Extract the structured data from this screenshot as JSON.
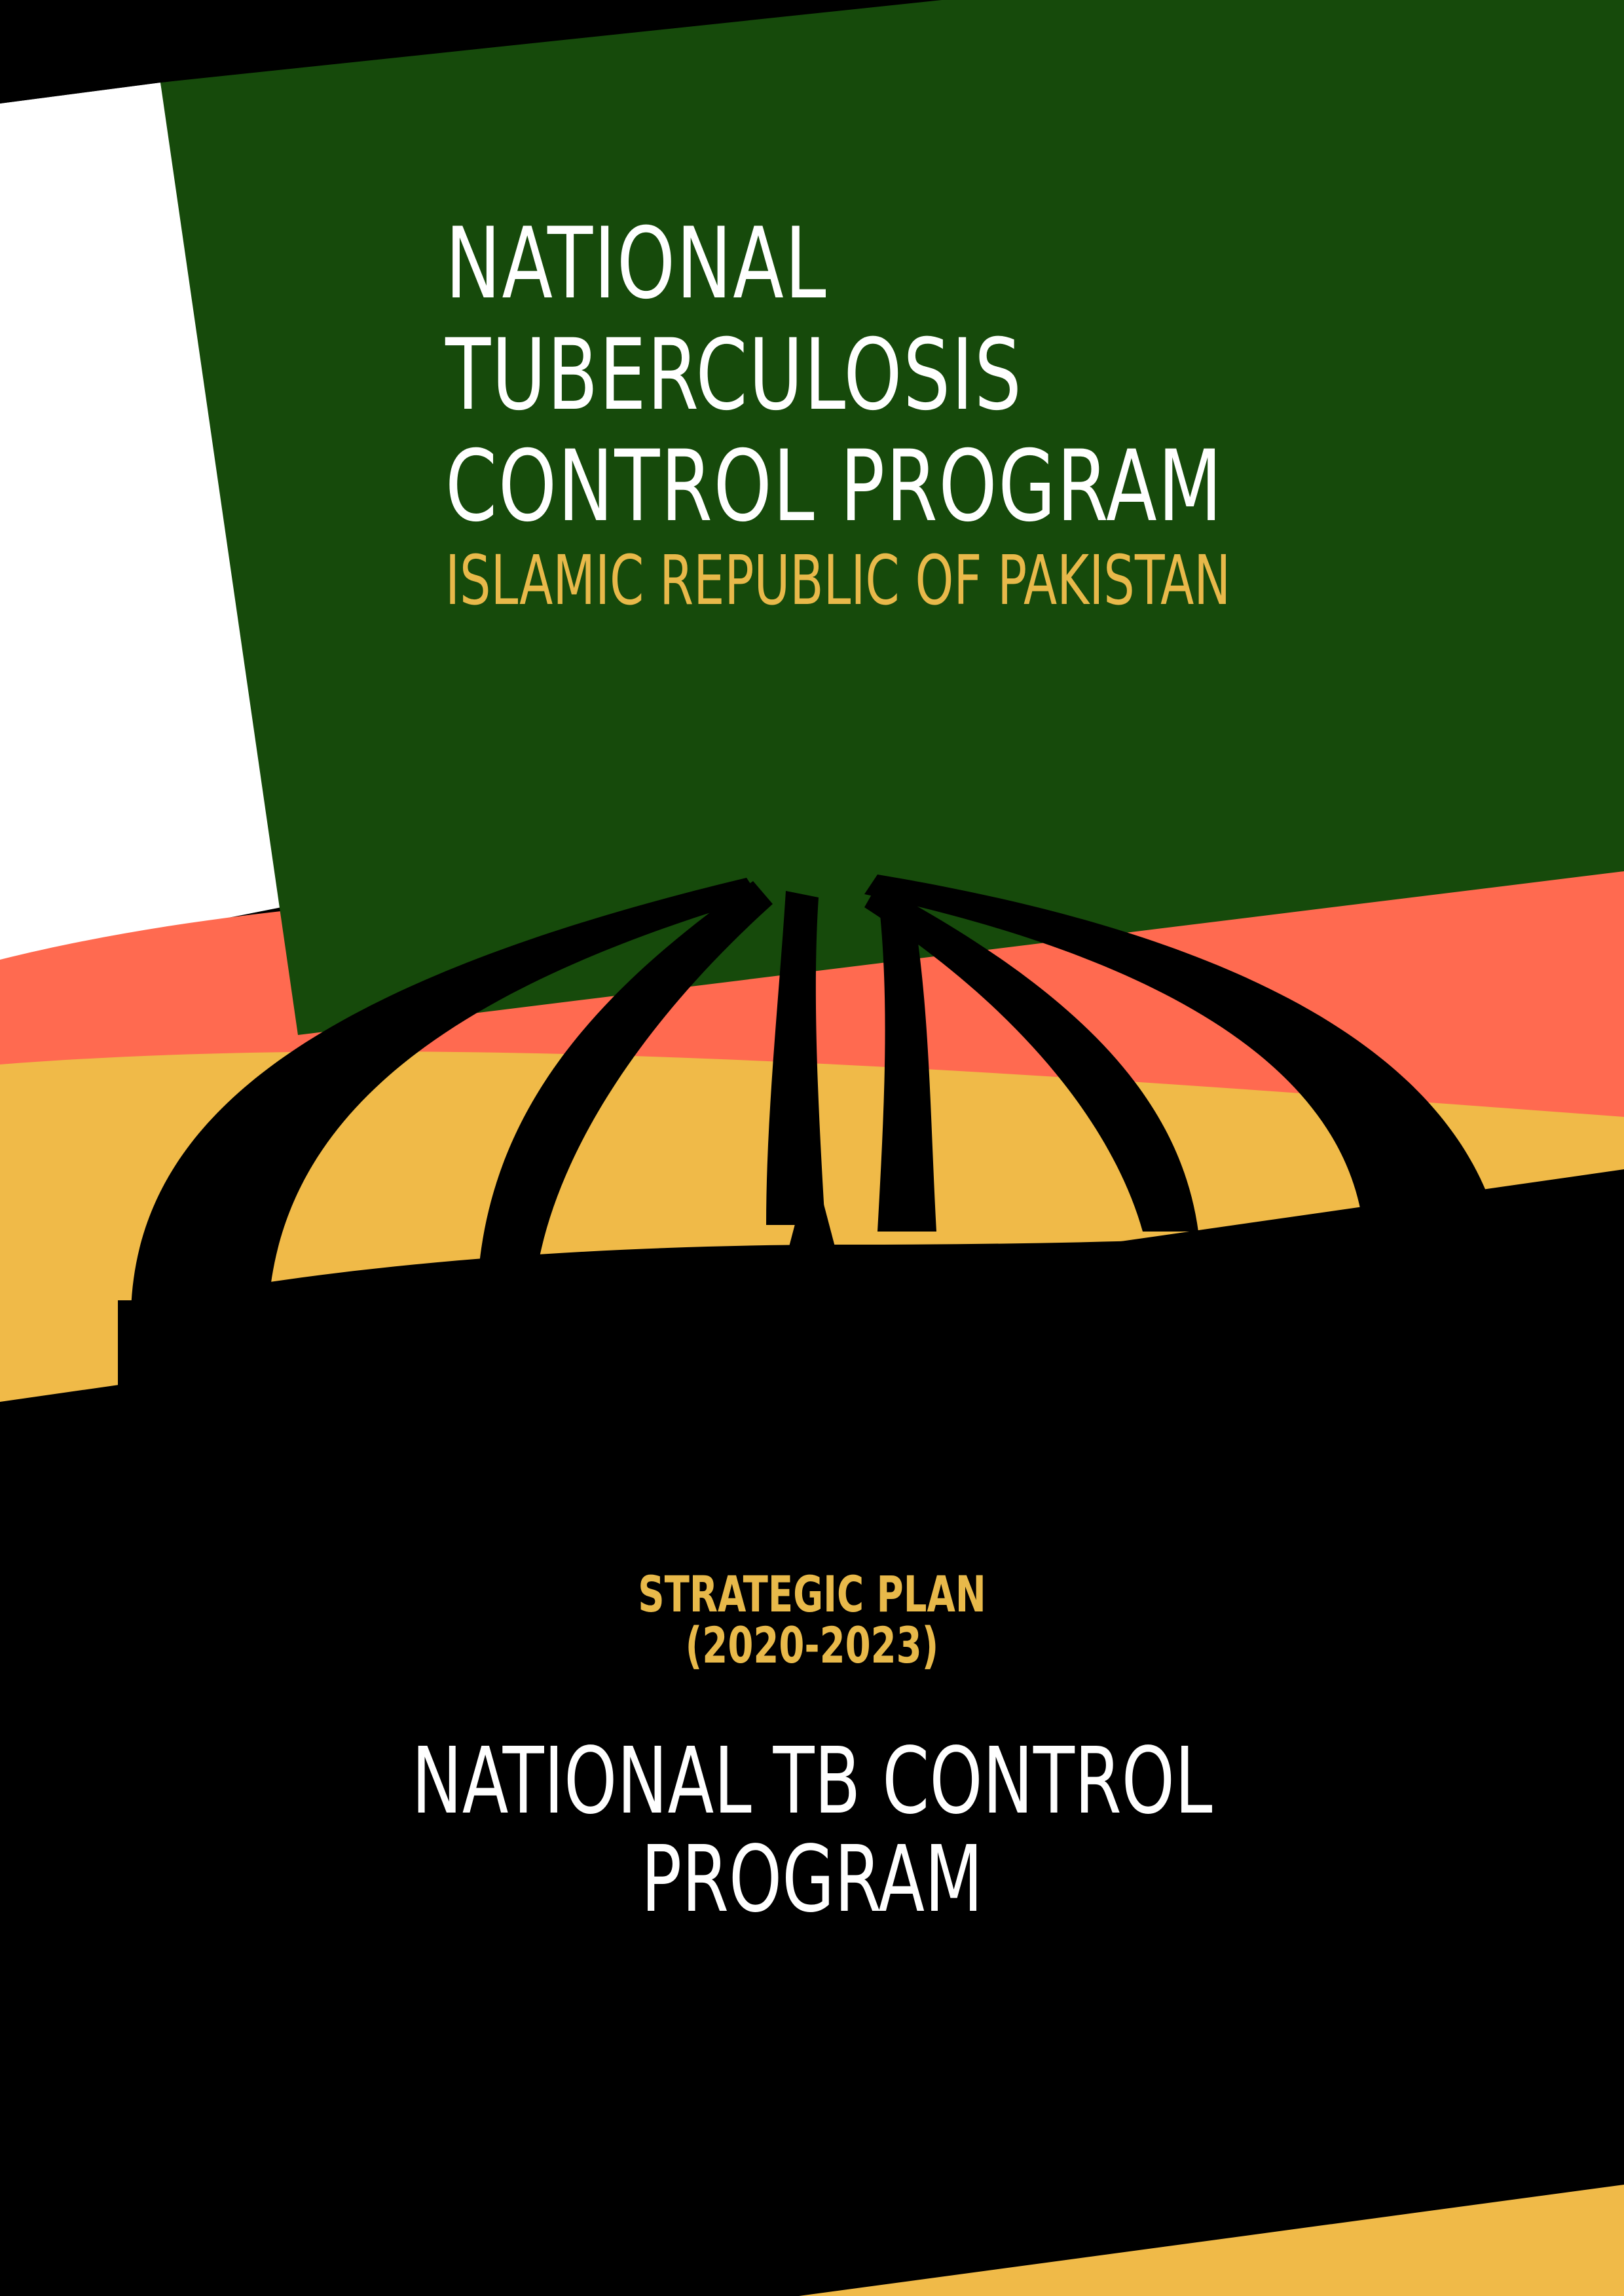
{
  "colors": {
    "background": "#000000",
    "green_panel": "#164a0b",
    "white_band": "#ffffff",
    "coral_band": "#ff6a50",
    "gold_band": "#f0ba48",
    "silhouette": "#000000",
    "title_text": "#ffffff",
    "accent_text": "#e8b94a"
  },
  "title": {
    "line1": "NATIONAL",
    "line2": "TUBERCULOSIS",
    "line3": "CONTROL PROGRAM"
  },
  "subtitle": "ISLAMIC REPUBLIC OF PAKISTAN",
  "plan": {
    "line1": "STRATEGIC PLAN",
    "line2": "(2020-2023)"
  },
  "program": {
    "line1": "NATIONAL TB CONTROL",
    "line2": "PROGRAM"
  },
  "artwork": {
    "monument_icon": "pakistan-monument-silhouette"
  }
}
